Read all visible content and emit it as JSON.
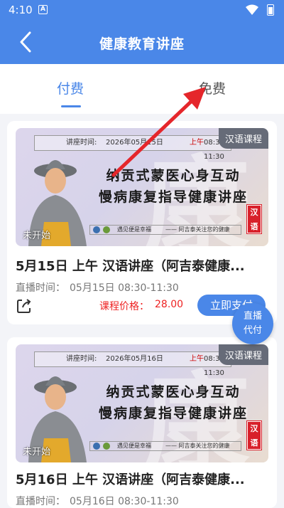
{
  "status_bar": {
    "time": "4:10",
    "notification_icon": "A"
  },
  "header": {
    "title": "健康教育讲座",
    "back_icon": "chevron-left-icon"
  },
  "tabs": [
    {
      "label": "付费",
      "active": true
    },
    {
      "label": "免费",
      "active": false
    }
  ],
  "courses": [
    {
      "tag": "汉语课程",
      "banner_time_label": "讲座时间:",
      "banner_date": "2026年05月15日",
      "banner_period": "上午",
      "banner_hours": "08:30-11:30",
      "banner_line1": "纳贡式蒙医心身互动",
      "banner_line2": "慢病康复指导健康讲座",
      "seal_line1": "汉",
      "seal_line2": "语",
      "banner_footer1": "遇见便是幸福",
      "banner_footer2": "—— 阿吉泰关注您的健康",
      "status": "未开始",
      "title": "5月15日 上午 汉语讲座（阿吉泰健康...",
      "time_label": "直播时间：",
      "time_value": "05月15日 08:30-11:30",
      "price_label": "课程价格：",
      "price_value": "28.00",
      "pay_label": "立即支付"
    },
    {
      "tag": "汉语课程",
      "banner_time_label": "讲座时间:",
      "banner_date": "2026年05月16日",
      "banner_period": "上午",
      "banner_hours": "08:30-11:30",
      "banner_line1": "纳贡式蒙医心身互动",
      "banner_line2": "慢病康复指导健康讲座",
      "seal_line1": "汉",
      "seal_line2": "语",
      "banner_footer1": "遇见便是幸福",
      "banner_footer2": "—— 阿吉泰关注您的健康",
      "status": "未开始",
      "title": "5月16日 上午 汉语讲座（阿吉泰健康...",
      "time_label": "直播时间：",
      "time_value": "05月16日 08:30-11:30"
    }
  ],
  "floating_button": {
    "line1": "直播",
    "line2": "代付"
  },
  "colors": {
    "primary": "#4a87e8",
    "price": "#ee2222",
    "annotation_arrow": "#e5262b"
  }
}
